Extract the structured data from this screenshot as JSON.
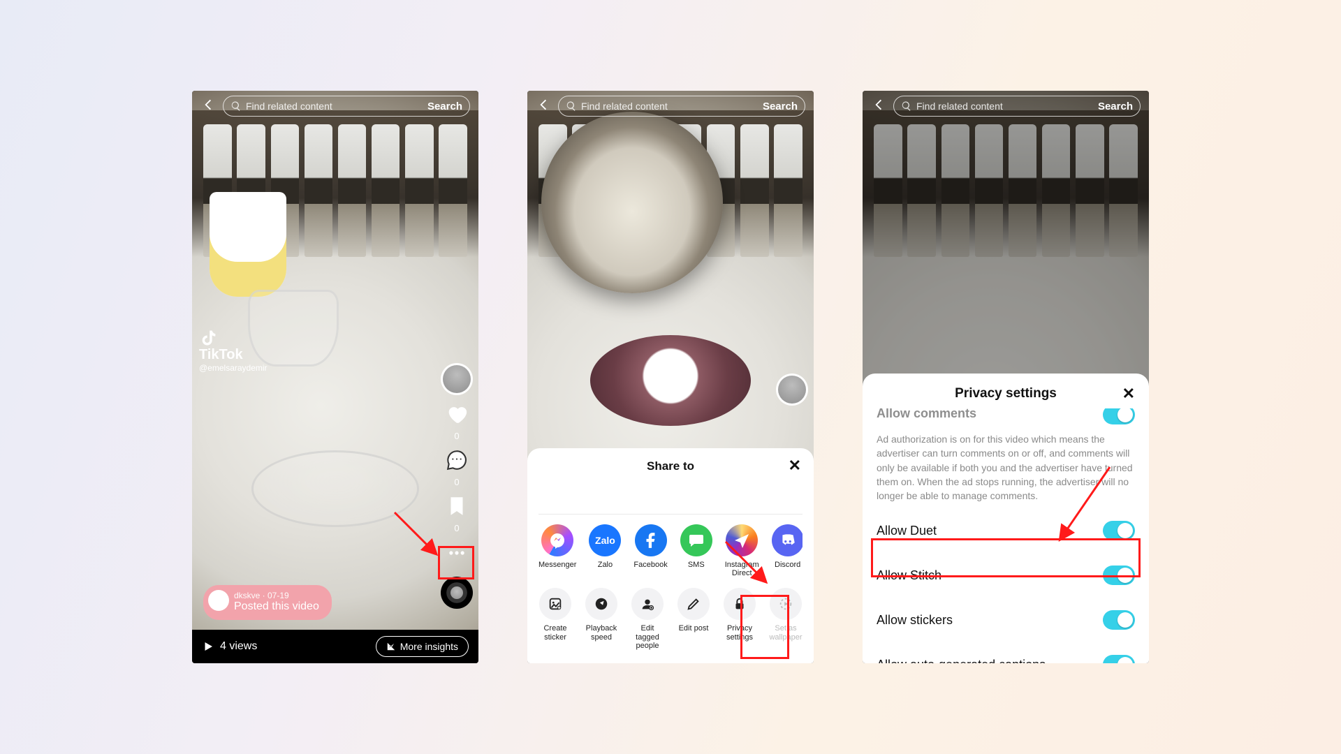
{
  "topbar": {
    "placeholder": "Find related content",
    "search_label": "Search"
  },
  "phone1": {
    "watermark": {
      "brand": "TikTok",
      "handle": "@emelsaraydemir"
    },
    "rail": {
      "like_count": "0",
      "comment_count": "0",
      "bookmark_count": "0"
    },
    "toast": {
      "line1": "dkskve · 07-19",
      "line2": "Posted this video"
    },
    "views_label": "4 views",
    "insights_label": "More insights"
  },
  "phone2": {
    "share_title": "Share to",
    "apps": [
      {
        "name": "Messenger"
      },
      {
        "name": "Zalo"
      },
      {
        "name": "Facebook"
      },
      {
        "name": "SMS"
      },
      {
        "name": "Instagram Direct"
      },
      {
        "name": "Discord"
      }
    ],
    "tools": [
      {
        "name": "Create sticker"
      },
      {
        "name": "Playback speed"
      },
      {
        "name": "Edit tagged people"
      },
      {
        "name": "Edit post"
      },
      {
        "name": "Privacy settings"
      },
      {
        "name": "Set as wallpaper"
      }
    ]
  },
  "phone3": {
    "title": "Privacy settings",
    "partial_label": "Allow comments",
    "helper": "Ad authorization is on for this video which means the advertiser can turn comments on or off, and comments will only be available if both you and the advertiser have turned them on. When the ad stops running, the advertiser will no longer be able to manage comments.",
    "rows": [
      {
        "label": "Allow Duet"
      },
      {
        "label": "Allow Stitch"
      },
      {
        "label": "Allow stickers"
      },
      {
        "label": "Allow auto-generated captions"
      }
    ]
  }
}
